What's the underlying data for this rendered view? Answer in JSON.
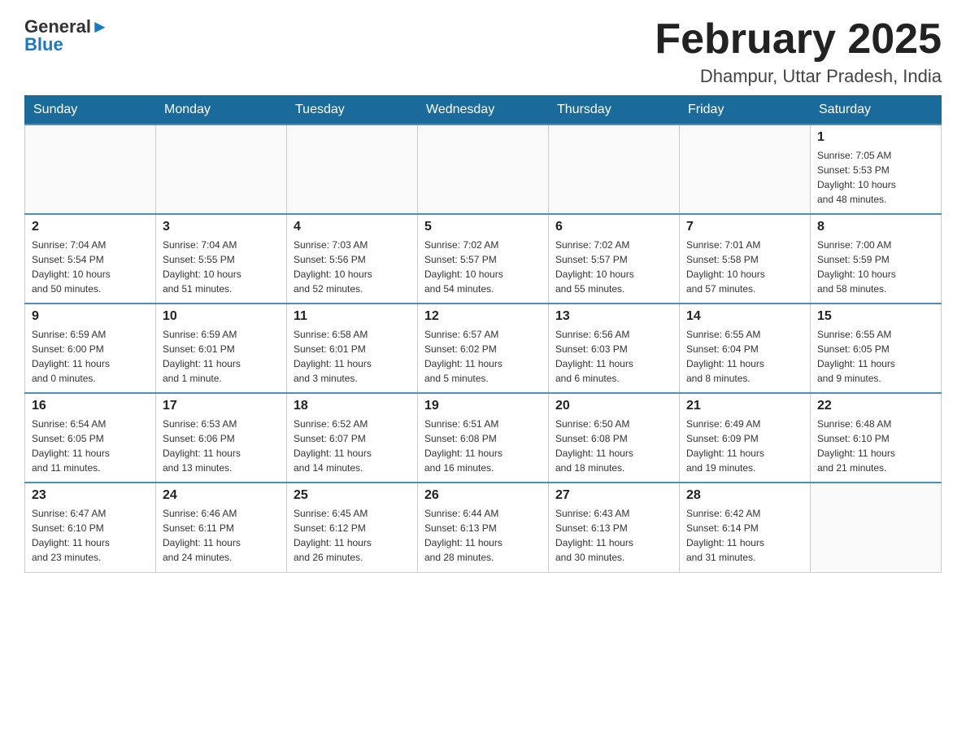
{
  "logo": {
    "general": "General",
    "blue": "Blue"
  },
  "title": "February 2025",
  "subtitle": "Dhampur, Uttar Pradesh, India",
  "weekdays": [
    "Sunday",
    "Monday",
    "Tuesday",
    "Wednesday",
    "Thursday",
    "Friday",
    "Saturday"
  ],
  "weeks": [
    [
      {
        "day": "",
        "info": ""
      },
      {
        "day": "",
        "info": ""
      },
      {
        "day": "",
        "info": ""
      },
      {
        "day": "",
        "info": ""
      },
      {
        "day": "",
        "info": ""
      },
      {
        "day": "",
        "info": ""
      },
      {
        "day": "1",
        "info": "Sunrise: 7:05 AM\nSunset: 5:53 PM\nDaylight: 10 hours\nand 48 minutes."
      }
    ],
    [
      {
        "day": "2",
        "info": "Sunrise: 7:04 AM\nSunset: 5:54 PM\nDaylight: 10 hours\nand 50 minutes."
      },
      {
        "day": "3",
        "info": "Sunrise: 7:04 AM\nSunset: 5:55 PM\nDaylight: 10 hours\nand 51 minutes."
      },
      {
        "day": "4",
        "info": "Sunrise: 7:03 AM\nSunset: 5:56 PM\nDaylight: 10 hours\nand 52 minutes."
      },
      {
        "day": "5",
        "info": "Sunrise: 7:02 AM\nSunset: 5:57 PM\nDaylight: 10 hours\nand 54 minutes."
      },
      {
        "day": "6",
        "info": "Sunrise: 7:02 AM\nSunset: 5:57 PM\nDaylight: 10 hours\nand 55 minutes."
      },
      {
        "day": "7",
        "info": "Sunrise: 7:01 AM\nSunset: 5:58 PM\nDaylight: 10 hours\nand 57 minutes."
      },
      {
        "day": "8",
        "info": "Sunrise: 7:00 AM\nSunset: 5:59 PM\nDaylight: 10 hours\nand 58 minutes."
      }
    ],
    [
      {
        "day": "9",
        "info": "Sunrise: 6:59 AM\nSunset: 6:00 PM\nDaylight: 11 hours\nand 0 minutes."
      },
      {
        "day": "10",
        "info": "Sunrise: 6:59 AM\nSunset: 6:01 PM\nDaylight: 11 hours\nand 1 minute."
      },
      {
        "day": "11",
        "info": "Sunrise: 6:58 AM\nSunset: 6:01 PM\nDaylight: 11 hours\nand 3 minutes."
      },
      {
        "day": "12",
        "info": "Sunrise: 6:57 AM\nSunset: 6:02 PM\nDaylight: 11 hours\nand 5 minutes."
      },
      {
        "day": "13",
        "info": "Sunrise: 6:56 AM\nSunset: 6:03 PM\nDaylight: 11 hours\nand 6 minutes."
      },
      {
        "day": "14",
        "info": "Sunrise: 6:55 AM\nSunset: 6:04 PM\nDaylight: 11 hours\nand 8 minutes."
      },
      {
        "day": "15",
        "info": "Sunrise: 6:55 AM\nSunset: 6:05 PM\nDaylight: 11 hours\nand 9 minutes."
      }
    ],
    [
      {
        "day": "16",
        "info": "Sunrise: 6:54 AM\nSunset: 6:05 PM\nDaylight: 11 hours\nand 11 minutes."
      },
      {
        "day": "17",
        "info": "Sunrise: 6:53 AM\nSunset: 6:06 PM\nDaylight: 11 hours\nand 13 minutes."
      },
      {
        "day": "18",
        "info": "Sunrise: 6:52 AM\nSunset: 6:07 PM\nDaylight: 11 hours\nand 14 minutes."
      },
      {
        "day": "19",
        "info": "Sunrise: 6:51 AM\nSunset: 6:08 PM\nDaylight: 11 hours\nand 16 minutes."
      },
      {
        "day": "20",
        "info": "Sunrise: 6:50 AM\nSunset: 6:08 PM\nDaylight: 11 hours\nand 18 minutes."
      },
      {
        "day": "21",
        "info": "Sunrise: 6:49 AM\nSunset: 6:09 PM\nDaylight: 11 hours\nand 19 minutes."
      },
      {
        "day": "22",
        "info": "Sunrise: 6:48 AM\nSunset: 6:10 PM\nDaylight: 11 hours\nand 21 minutes."
      }
    ],
    [
      {
        "day": "23",
        "info": "Sunrise: 6:47 AM\nSunset: 6:10 PM\nDaylight: 11 hours\nand 23 minutes."
      },
      {
        "day": "24",
        "info": "Sunrise: 6:46 AM\nSunset: 6:11 PM\nDaylight: 11 hours\nand 24 minutes."
      },
      {
        "day": "25",
        "info": "Sunrise: 6:45 AM\nSunset: 6:12 PM\nDaylight: 11 hours\nand 26 minutes."
      },
      {
        "day": "26",
        "info": "Sunrise: 6:44 AM\nSunset: 6:13 PM\nDaylight: 11 hours\nand 28 minutes."
      },
      {
        "day": "27",
        "info": "Sunrise: 6:43 AM\nSunset: 6:13 PM\nDaylight: 11 hours\nand 30 minutes."
      },
      {
        "day": "28",
        "info": "Sunrise: 6:42 AM\nSunset: 6:14 PM\nDaylight: 11 hours\nand 31 minutes."
      },
      {
        "day": "",
        "info": ""
      }
    ]
  ]
}
